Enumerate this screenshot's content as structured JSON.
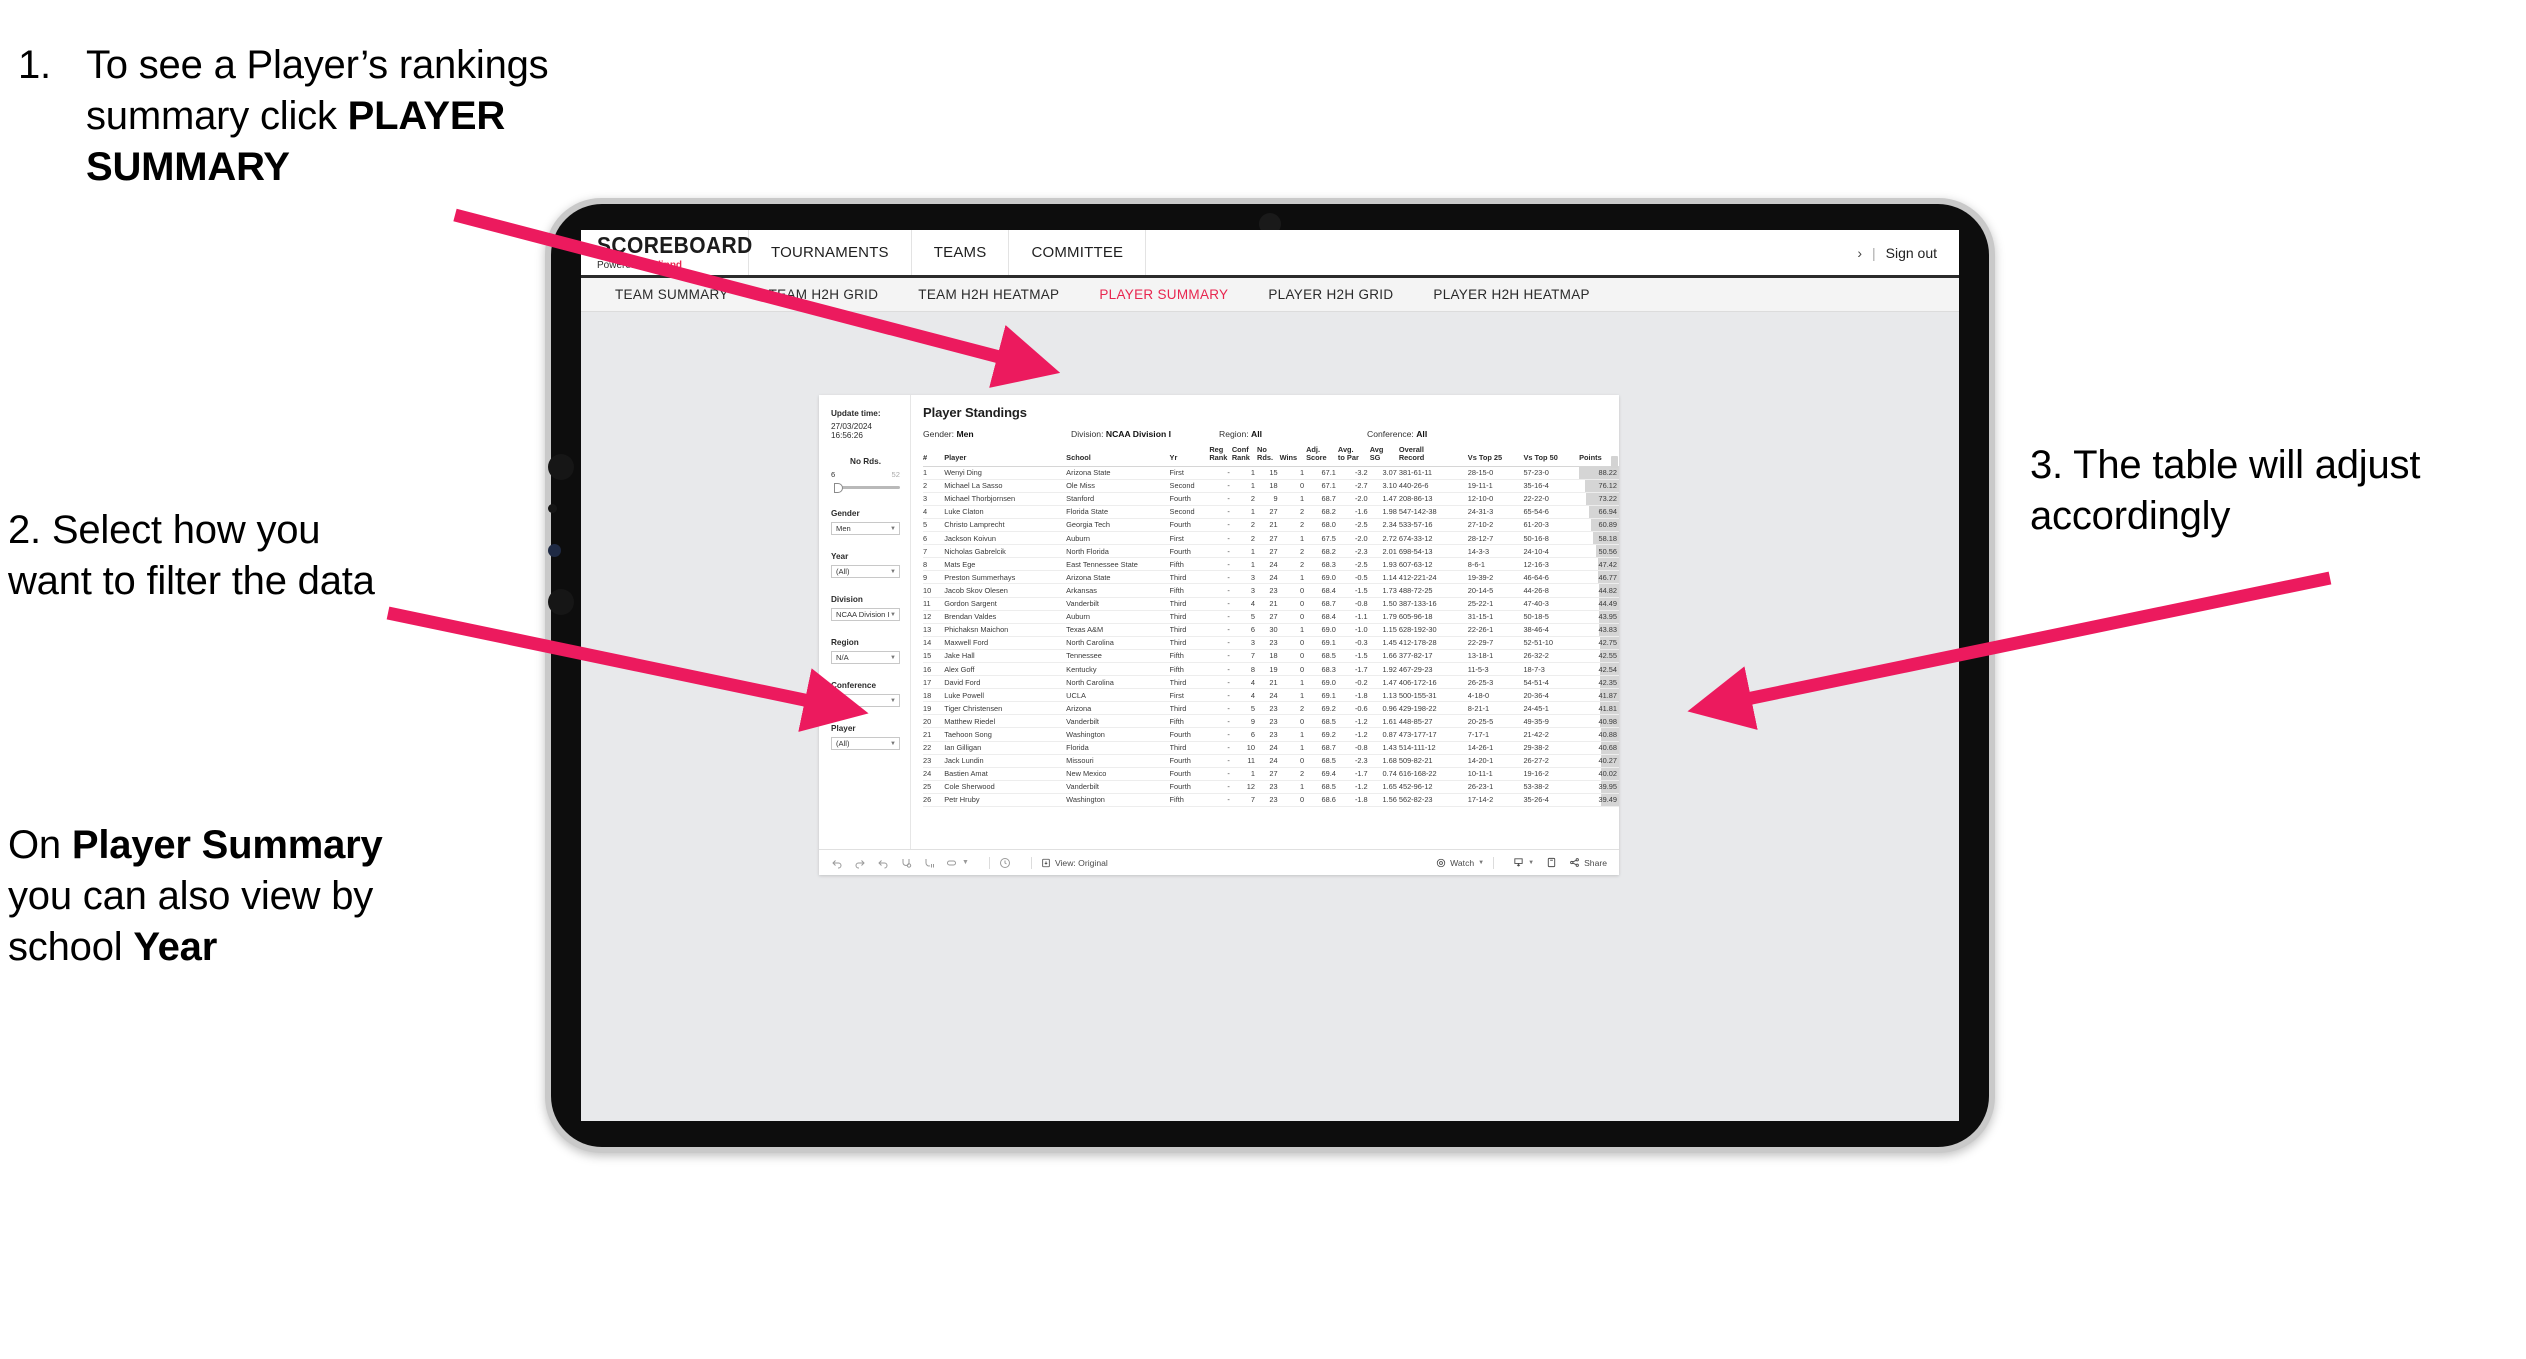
{
  "annotations": {
    "one": {
      "number": "1.",
      "line1": "To see a Player’s rankings",
      "line2_prefix": "summary click ",
      "line2_bold": "PLAYER",
      "line3_bold": "SUMMARY"
    },
    "two": {
      "text": "2. Select how you want to filter the data"
    },
    "two_b": {
      "prefix": "On ",
      "bold1": "Player Summary",
      "mid": " you can also view by school ",
      "bold2": "Year"
    },
    "three": {
      "text": "3. The table will adjust accordingly"
    }
  },
  "app": {
    "logo": {
      "main": "SCOREBOARD",
      "sub_prefix": "Powered by ",
      "brand": "clippd"
    },
    "top_nav": [
      "TOURNAMENTS",
      "TEAMS",
      "COMMITTEE"
    ],
    "header_right": {
      "truncated": "›",
      "separator": "|",
      "sign_out": "Sign out"
    },
    "sub_nav": [
      {
        "label": "TEAM SUMMARY",
        "active": false
      },
      {
        "label": "TEAM H2H GRID",
        "active": false
      },
      {
        "label": "TEAM H2H HEATMAP",
        "active": false
      },
      {
        "label": "PLAYER SUMMARY",
        "active": true
      },
      {
        "label": "PLAYER H2H GRID",
        "active": false
      },
      {
        "label": "PLAYER H2H HEATMAP",
        "active": false
      }
    ]
  },
  "filters": {
    "update_time_label": "Update time:",
    "update_time_value": "27/03/2024 16:56:26",
    "slider": {
      "label": "No Rds.",
      "min": "6",
      "max": "52"
    },
    "selects": [
      {
        "label": "Gender",
        "value": "Men"
      },
      {
        "label": "Year",
        "value": "(All)"
      },
      {
        "label": "Division",
        "value": "NCAA Division I"
      },
      {
        "label": "Region",
        "value": "N/A"
      },
      {
        "label": "Conference",
        "value": "(All)"
      },
      {
        "label": "Player",
        "value": "(All)"
      }
    ]
  },
  "viz": {
    "title": "Player Standings",
    "summary": [
      {
        "label": "Gender:",
        "value": "Men"
      },
      {
        "label": "Division:",
        "value": "NCAA Division I"
      },
      {
        "label": "Region:",
        "value": "All"
      },
      {
        "label": "Conference:",
        "value": "All"
      }
    ]
  },
  "table": {
    "columns": [
      "#",
      "Player",
      "School",
      "Yr",
      "Reg Rank",
      "Conf Rank",
      "No Rds.",
      "Wins",
      "Adj. Score",
      "Avg. to Par",
      "Avg SG",
      "Overall Record",
      "Vs Top 25",
      "Vs Top 50",
      "Points"
    ],
    "rows": [
      [
        "1",
        "Wenyi Ding",
        "Arizona State",
        "First",
        "-",
        "1",
        "15",
        "1",
        "67.1",
        "-3.2",
        "3.07",
        "381-61-11",
        "28-15-0",
        "57-23-0",
        "88.22"
      ],
      [
        "2",
        "Michael La Sasso",
        "Ole Miss",
        "Second",
        "-",
        "1",
        "18",
        "0",
        "67.1",
        "-2.7",
        "3.10",
        "440-26-6",
        "19-11-1",
        "35-16-4",
        "76.12"
      ],
      [
        "3",
        "Michael Thorbjornsen",
        "Stanford",
        "Fourth",
        "-",
        "2",
        "9",
        "1",
        "68.7",
        "-2.0",
        "1.47",
        "208-86-13",
        "12-10-0",
        "22-22-0",
        "73.22"
      ],
      [
        "4",
        "Luke Claton",
        "Florida State",
        "Second",
        "-",
        "1",
        "27",
        "2",
        "68.2",
        "-1.6",
        "1.98",
        "547-142-38",
        "24-31-3",
        "65-54-6",
        "66.94"
      ],
      [
        "5",
        "Christo Lamprecht",
        "Georgia Tech",
        "Fourth",
        "-",
        "2",
        "21",
        "2",
        "68.0",
        "-2.5",
        "2.34",
        "533-57-16",
        "27-10-2",
        "61-20-3",
        "60.89"
      ],
      [
        "6",
        "Jackson Koivun",
        "Auburn",
        "First",
        "-",
        "2",
        "27",
        "1",
        "67.5",
        "-2.0",
        "2.72",
        "674-33-12",
        "28-12-7",
        "50-16-8",
        "58.18"
      ],
      [
        "7",
        "Nicholas Gabrelcik",
        "North Florida",
        "Fourth",
        "-",
        "1",
        "27",
        "2",
        "68.2",
        "-2.3",
        "2.01",
        "698-54-13",
        "14-3-3",
        "24-10-4",
        "50.56"
      ],
      [
        "8",
        "Mats Ege",
        "East Tennessee State",
        "Fifth",
        "-",
        "1",
        "24",
        "2",
        "68.3",
        "-2.5",
        "1.93",
        "607-63-12",
        "8-6-1",
        "12-16-3",
        "47.42"
      ],
      [
        "9",
        "Preston Summerhays",
        "Arizona State",
        "Third",
        "-",
        "3",
        "24",
        "1",
        "69.0",
        "-0.5",
        "1.14",
        "412-221-24",
        "19-39-2",
        "46-64-6",
        "46.77"
      ],
      [
        "10",
        "Jacob Skov Olesen",
        "Arkansas",
        "Fifth",
        "-",
        "3",
        "23",
        "0",
        "68.4",
        "-1.5",
        "1.73",
        "488-72-25",
        "20-14-5",
        "44-26-8",
        "44.82"
      ],
      [
        "11",
        "Gordon Sargent",
        "Vanderbilt",
        "Third",
        "-",
        "4",
        "21",
        "0",
        "68.7",
        "-0.8",
        "1.50",
        "387-133-16",
        "25-22-1",
        "47-40-3",
        "44.49"
      ],
      [
        "12",
        "Brendan Valdes",
        "Auburn",
        "Third",
        "-",
        "5",
        "27",
        "0",
        "68.4",
        "-1.1",
        "1.79",
        "605-96-18",
        "31-15-1",
        "50-18-5",
        "43.95"
      ],
      [
        "13",
        "Phichaksn Maichon",
        "Texas A&M",
        "Third",
        "-",
        "6",
        "30",
        "1",
        "69.0",
        "-1.0",
        "1.15",
        "628-192-30",
        "22-26-1",
        "38-46-4",
        "43.83"
      ],
      [
        "14",
        "Maxwell Ford",
        "North Carolina",
        "Third",
        "-",
        "3",
        "23",
        "0",
        "69.1",
        "-0.3",
        "1.45",
        "412-178-28",
        "22-29-7",
        "52-51-10",
        "42.75"
      ],
      [
        "15",
        "Jake Hall",
        "Tennessee",
        "Fifth",
        "-",
        "7",
        "18",
        "0",
        "68.5",
        "-1.5",
        "1.66",
        "377-82-17",
        "13-18-1",
        "26-32-2",
        "42.55"
      ],
      [
        "16",
        "Alex Goff",
        "Kentucky",
        "Fifth",
        "-",
        "8",
        "19",
        "0",
        "68.3",
        "-1.7",
        "1.92",
        "467-29-23",
        "11-5-3",
        "18-7-3",
        "42.54"
      ],
      [
        "17",
        "David Ford",
        "North Carolina",
        "Third",
        "-",
        "4",
        "21",
        "1",
        "69.0",
        "-0.2",
        "1.47",
        "406-172-16",
        "26-25-3",
        "54-51-4",
        "42.35"
      ],
      [
        "18",
        "Luke Powell",
        "UCLA",
        "First",
        "-",
        "4",
        "24",
        "1",
        "69.1",
        "-1.8",
        "1.13",
        "500-155-31",
        "4-18-0",
        "20-36-4",
        "41.87"
      ],
      [
        "19",
        "Tiger Christensen",
        "Arizona",
        "Third",
        "-",
        "5",
        "23",
        "2",
        "69.2",
        "-0.6",
        "0.96",
        "429-198-22",
        "8-21-1",
        "24-45-1",
        "41.81"
      ],
      [
        "20",
        "Matthew Riedel",
        "Vanderbilt",
        "Fifth",
        "-",
        "9",
        "23",
        "0",
        "68.5",
        "-1.2",
        "1.61",
        "448-85-27",
        "20-25-5",
        "49-35-9",
        "40.98"
      ],
      [
        "21",
        "Taehoon Song",
        "Washington",
        "Fourth",
        "-",
        "6",
        "23",
        "1",
        "69.2",
        "-1.2",
        "0.87",
        "473-177-17",
        "7-17-1",
        "21-42-2",
        "40.88"
      ],
      [
        "22",
        "Ian Gilligan",
        "Florida",
        "Third",
        "-",
        "10",
        "24",
        "1",
        "68.7",
        "-0.8",
        "1.43",
        "514-111-12",
        "14-26-1",
        "29-38-2",
        "40.68"
      ],
      [
        "23",
        "Jack Lundin",
        "Missouri",
        "Fourth",
        "-",
        "11",
        "24",
        "0",
        "68.5",
        "-2.3",
        "1.68",
        "509-82-21",
        "14-20-1",
        "26-27-2",
        "40.27"
      ],
      [
        "24",
        "Bastien Amat",
        "New Mexico",
        "Fourth",
        "-",
        "1",
        "27",
        "2",
        "69.4",
        "-1.7",
        "0.74",
        "616-168-22",
        "10-11-1",
        "19-16-2",
        "40.02"
      ],
      [
        "25",
        "Cole Sherwood",
        "Vanderbilt",
        "Fourth",
        "-",
        "12",
        "23",
        "1",
        "68.5",
        "-1.2",
        "1.65",
        "452-96-12",
        "26-23-1",
        "53-38-2",
        "39.95"
      ],
      [
        "26",
        "Petr Hruby",
        "Washington",
        "Fifth",
        "-",
        "7",
        "23",
        "0",
        "68.6",
        "-1.8",
        "1.56",
        "562-82-23",
        "17-14-2",
        "35-26-4",
        "39.49"
      ]
    ],
    "points_max": 88.22
  },
  "toolbar": {
    "icons": [
      "undo-icon",
      "redo-icon",
      "revert-icon",
      "refresh-icon",
      "pause-icon",
      "device-icon",
      "dropdown-icon",
      "clock-icon"
    ],
    "view_label": "View: Original",
    "watch_label": "Watch",
    "share_label": "Share"
  },
  "colors": {
    "accent": "#e8264f",
    "arrow": "#ec1a5e",
    "bezel": "#0d0d0d",
    "screen_bg": "#e8e9eb"
  }
}
